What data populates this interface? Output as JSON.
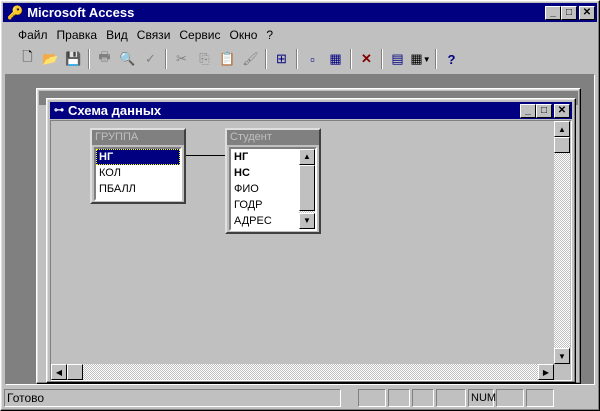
{
  "app": {
    "title": "Microsoft Access"
  },
  "menu": [
    "Файл",
    "Правка",
    "Вид",
    "Связи",
    "Сервис",
    "Окно",
    "?"
  ],
  "toolbar": {
    "icons": [
      "new-icon",
      "open-icon",
      "save-icon",
      "print-icon",
      "print-preview-icon",
      "spelling-icon",
      "cut-icon",
      "copy-icon",
      "paste-icon",
      "format-painter-icon",
      "show-table-icon",
      "show-direct-icon",
      "show-all-icon",
      "delete-icon",
      "database-window-icon",
      "new-object-icon",
      "help-icon"
    ]
  },
  "schema_window": {
    "title": "Схема данных"
  },
  "tables": [
    {
      "name": "ГРУППА",
      "fields": [
        "НГ",
        "КОЛ",
        "ПБАЛЛ"
      ],
      "selected": 0
    },
    {
      "name": "Студент",
      "fields": [
        "НГ",
        "НС",
        "ФИО",
        "ГОДР",
        "АДРЕС"
      ]
    }
  ],
  "status": {
    "text": "Готово",
    "indicators": [
      "",
      "",
      "",
      "",
      "NUM",
      "",
      ""
    ]
  },
  "colors": {
    "title": "#000080",
    "workspace": "#808080",
    "face": "#c0c0c0"
  }
}
